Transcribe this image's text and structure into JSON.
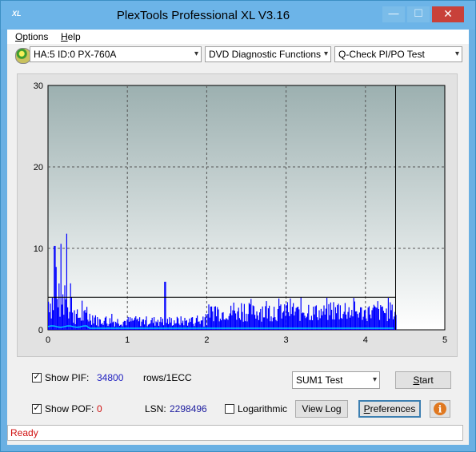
{
  "window": {
    "title": "PlexTools Professional XL V3.16",
    "app_icon_text": "XL",
    "minimize_glyph": "—",
    "maximize_glyph": "☐",
    "close_glyph": "✕"
  },
  "menu": [
    {
      "label_u": "O",
      "label_rest": "ptions"
    },
    {
      "label_u": "H",
      "label_rest": "elp"
    }
  ],
  "toolbar": {
    "drive_icon": "disc-icon",
    "drive_select": "HA:5 ID:0  PX-760A",
    "function_select": "DVD Diagnostic Functions",
    "test_select": "Q-Check PI/PO Test",
    "arrow_glyph": "▾"
  },
  "chart_data": {
    "type": "bar",
    "x_ticks": [
      "0",
      "1",
      "2",
      "3",
      "4",
      "5"
    ],
    "y_ticks": [
      "0",
      "10",
      "20",
      "30"
    ],
    "xlim": [
      0,
      5
    ],
    "ylim": [
      0,
      30
    ],
    "grid": true,
    "threshold_value": 4,
    "cursor_x": 4.38,
    "data_end_x": 4.38,
    "series": [
      {
        "color": "#0000ff"
      },
      {
        "color": "#00c8ff"
      }
    ],
    "plot_bg_top": "#9cb0b0",
    "plot_bg_bottom": "#ffffff"
  },
  "controls": {
    "show_pif_label": "Show PIF:",
    "pif_value": "34800",
    "rows_label": "rows/1ECC",
    "show_pof_label": "Show POF:",
    "pof_value": "0",
    "lsn_label": "LSN:",
    "lsn_value": "2298496",
    "logarithmic_label": "Logarithmic",
    "sum_select": "SUM1 Test",
    "start_u": "S",
    "start_rest": "tart",
    "viewlog_label": "View Log",
    "prefs_u": "P",
    "prefs_rest": "references",
    "info_glyph": "i",
    "pif_checked": "✓",
    "pof_checked": "✓"
  },
  "status": {
    "text": "Ready"
  },
  "colors": {
    "pif_value": "#2020c0",
    "pof_value": "#d01010",
    "lsn_value": "#2020a0",
    "status": "#d01010"
  }
}
